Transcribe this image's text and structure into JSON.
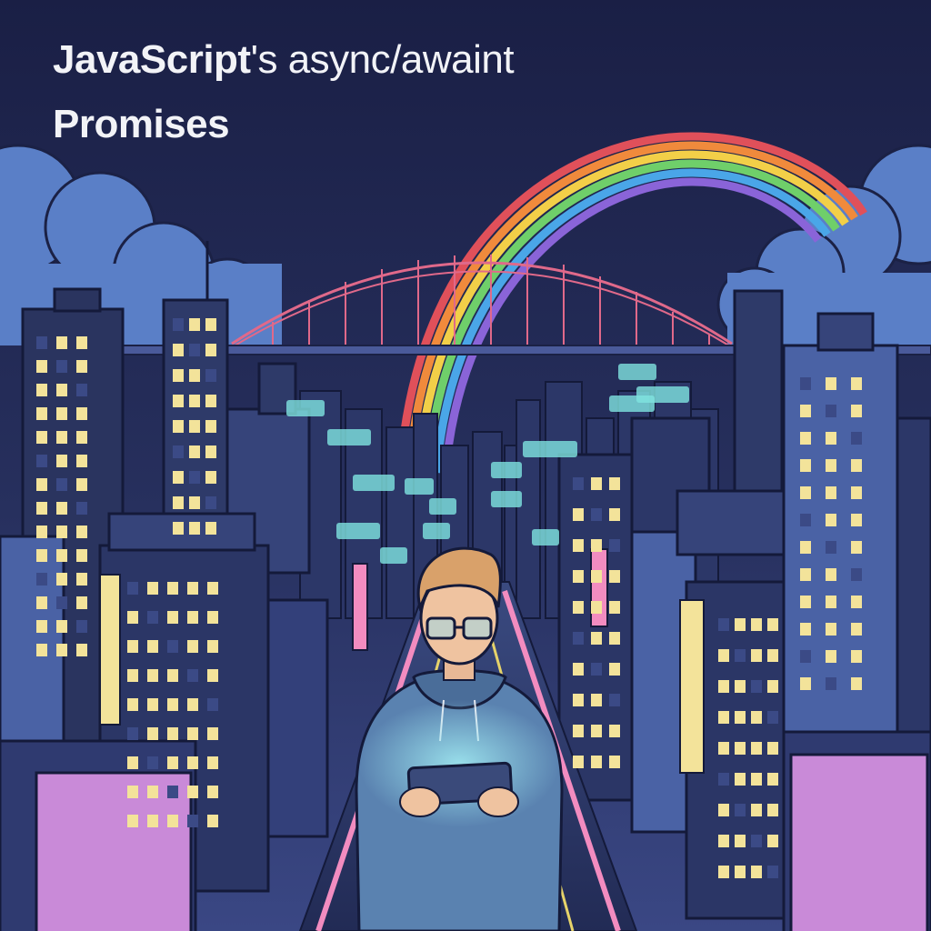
{
  "title": {
    "line1_bold": "JavaScript",
    "line1_rest": "'s async/awaint",
    "line2": "Promises"
  },
  "colors": {
    "sky_top": "#1a1f45",
    "sky_bottom": "#33407a",
    "cloud": "#5a7fc7",
    "bridge": "#e0698a",
    "rainbow": [
      "#e0505a",
      "#f08a3c",
      "#f2cf48",
      "#6fcf6a",
      "#4aa6e8",
      "#8a64d8"
    ],
    "window_lit": "#f3e39a",
    "code_bubble": "#7fe3e0",
    "neon_pink": "#f28cc0",
    "hoodie": "#5a82b0"
  },
  "icons": {
    "hero": "developer-with-tablet",
    "bridge": "suspension-bridge",
    "rainbow": "rainbow-arc"
  }
}
